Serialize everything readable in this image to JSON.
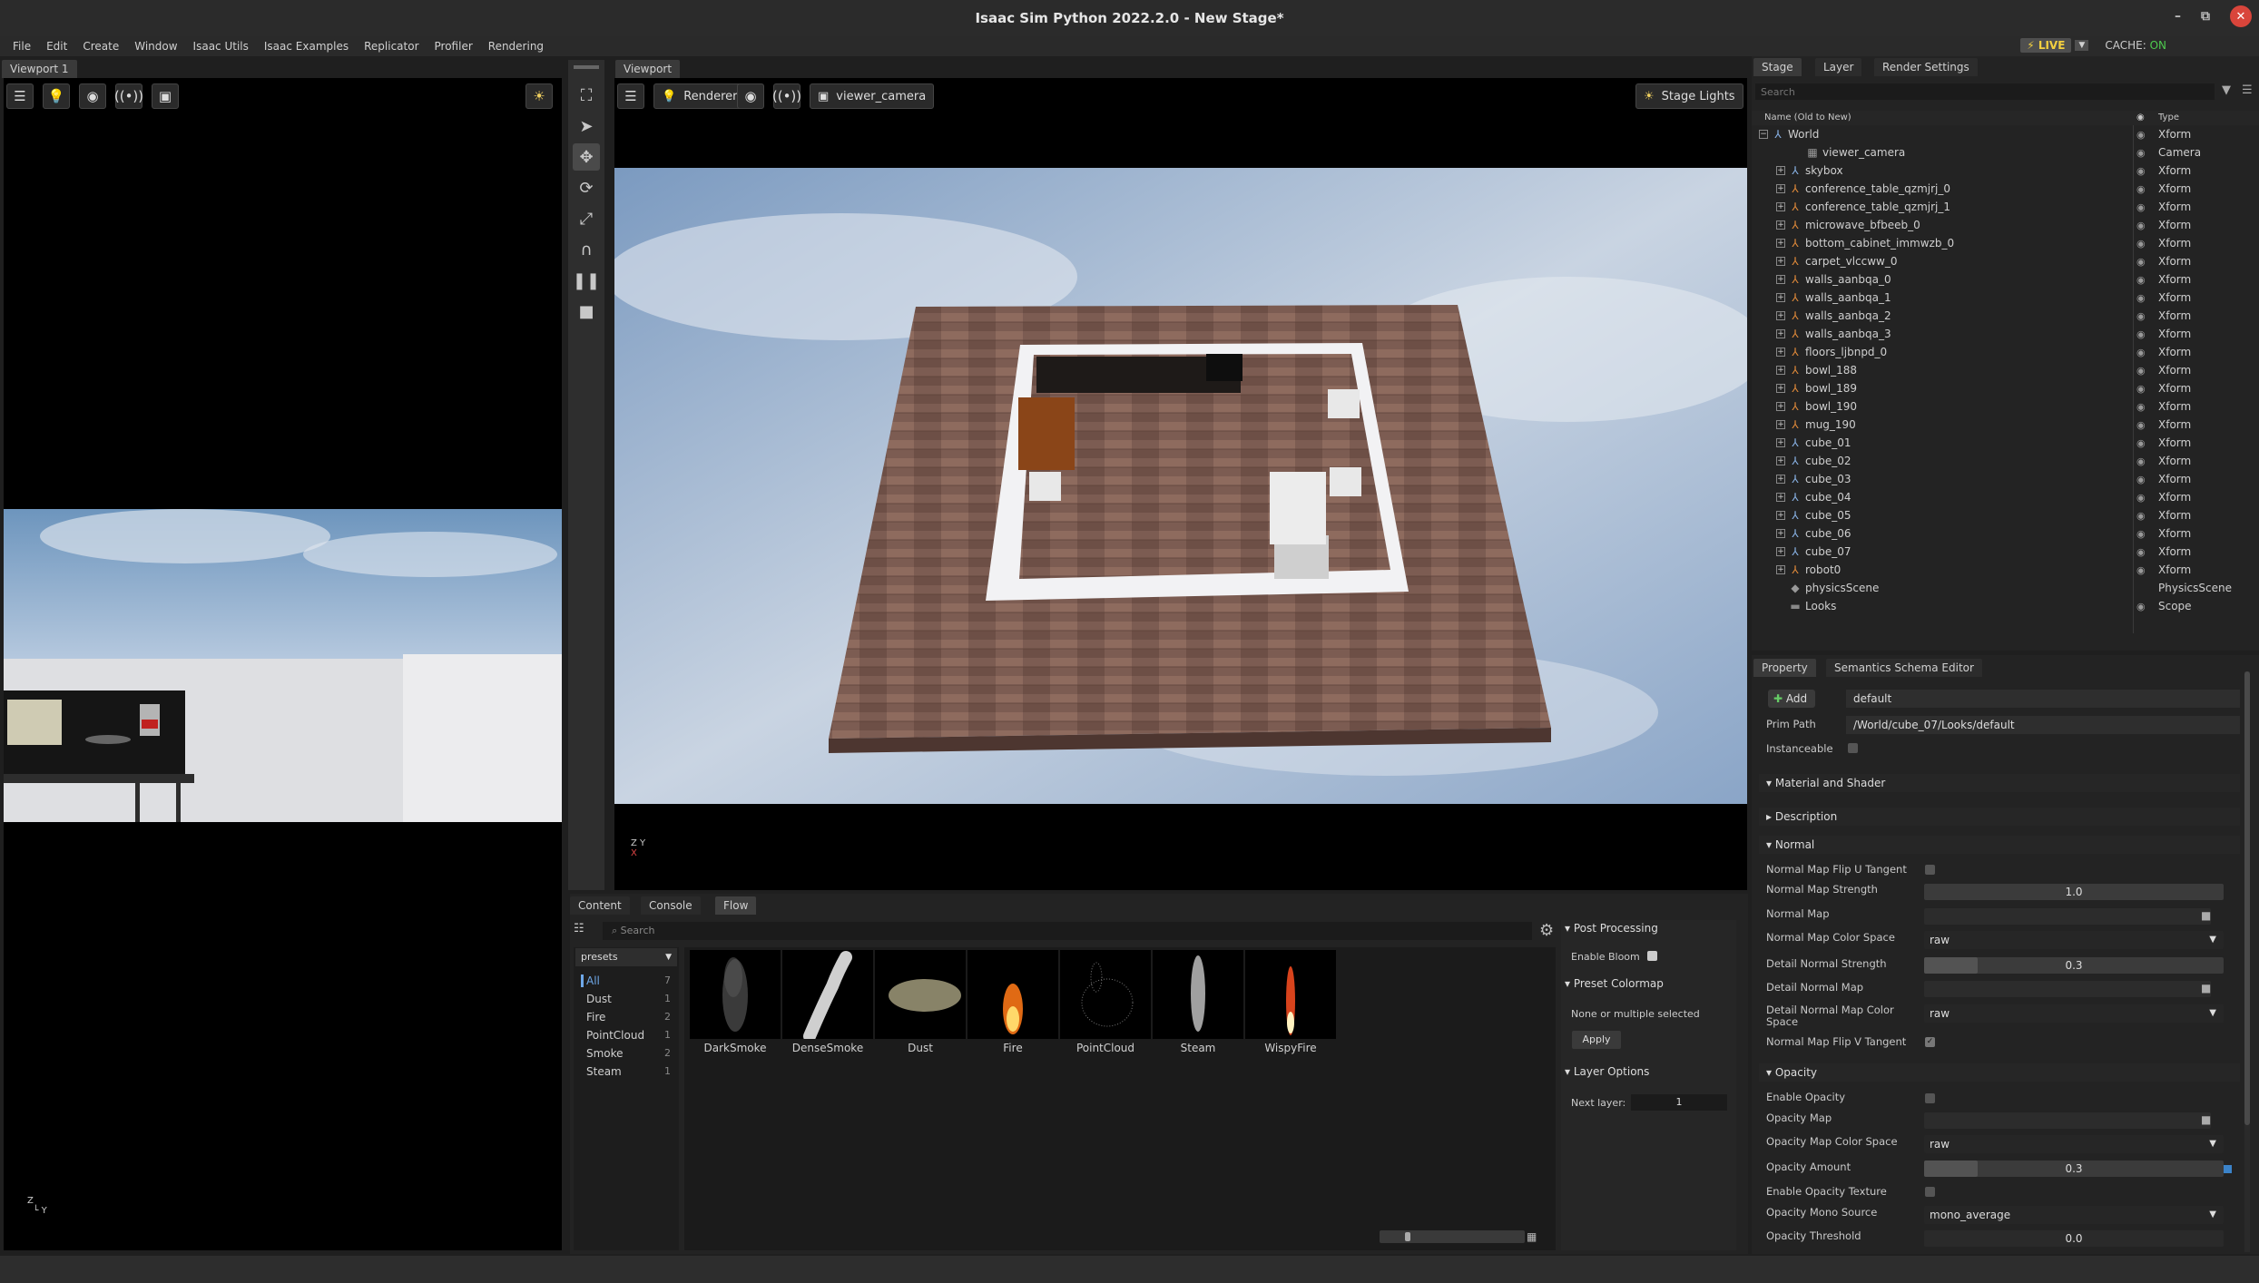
{
  "window": {
    "title": "Isaac Sim Python 2022.2.0 - New Stage*",
    "min": "–",
    "max": "⧉",
    "close": "✕"
  },
  "menu": [
    "File",
    "Edit",
    "Create",
    "Window",
    "Isaac Utils",
    "Isaac Examples",
    "Replicator",
    "Profiler",
    "Rendering"
  ],
  "status": {
    "live": "LIVE",
    "live_icon": "⚡",
    "cache_label": "CACHE:",
    "cache_value": "ON"
  },
  "viewport1": {
    "tab": "Viewport 1",
    "axis_z": "Z",
    "axis_y": "Y"
  },
  "viewport": {
    "tab": "Viewport",
    "renderer": "Renderer",
    "camera": "viewer_camera",
    "stage_lights": "Stage Lights",
    "axis_z": "Z",
    "axis_y": "Y",
    "axis_x": "X"
  },
  "stage": {
    "tabs": [
      "Stage",
      "Layer",
      "Render Settings"
    ],
    "search_placeholder": "Search",
    "col_name": "Name (Old to New)",
    "col_type": "Type",
    "rows": [
      {
        "name": "World",
        "type": "Xform",
        "depth": 0,
        "exp": "−",
        "icon": "xform"
      },
      {
        "name": "viewer_camera",
        "type": "Camera",
        "depth": 2,
        "exp": "",
        "icon": "camera"
      },
      {
        "name": "skybox",
        "type": "Xform",
        "depth": 1,
        "exp": "+",
        "icon": "xform"
      },
      {
        "name": "conference_table_qzmjrj_0",
        "type": "Xform",
        "depth": 1,
        "exp": "+",
        "icon": "ref"
      },
      {
        "name": "conference_table_qzmjrj_1",
        "type": "Xform",
        "depth": 1,
        "exp": "+",
        "icon": "ref"
      },
      {
        "name": "microwave_bfbeeb_0",
        "type": "Xform",
        "depth": 1,
        "exp": "+",
        "icon": "ref"
      },
      {
        "name": "bottom_cabinet_immwzb_0",
        "type": "Xform",
        "depth": 1,
        "exp": "+",
        "icon": "ref"
      },
      {
        "name": "carpet_vlccww_0",
        "type": "Xform",
        "depth": 1,
        "exp": "+",
        "icon": "ref"
      },
      {
        "name": "walls_aanbqa_0",
        "type": "Xform",
        "depth": 1,
        "exp": "+",
        "icon": "ref"
      },
      {
        "name": "walls_aanbqa_1",
        "type": "Xform",
        "depth": 1,
        "exp": "+",
        "icon": "ref"
      },
      {
        "name": "walls_aanbqa_2",
        "type": "Xform",
        "depth": 1,
        "exp": "+",
        "icon": "ref"
      },
      {
        "name": "walls_aanbqa_3",
        "type": "Xform",
        "depth": 1,
        "exp": "+",
        "icon": "ref"
      },
      {
        "name": "floors_ljbnpd_0",
        "type": "Xform",
        "depth": 1,
        "exp": "+",
        "icon": "ref"
      },
      {
        "name": "bowl_188",
        "type": "Xform",
        "depth": 1,
        "exp": "+",
        "icon": "ref"
      },
      {
        "name": "bowl_189",
        "type": "Xform",
        "depth": 1,
        "exp": "+",
        "icon": "ref"
      },
      {
        "name": "bowl_190",
        "type": "Xform",
        "depth": 1,
        "exp": "+",
        "icon": "ref"
      },
      {
        "name": "mug_190",
        "type": "Xform",
        "depth": 1,
        "exp": "+",
        "icon": "ref"
      },
      {
        "name": "cube_01",
        "type": "Xform",
        "depth": 1,
        "exp": "+",
        "icon": "xform"
      },
      {
        "name": "cube_02",
        "type": "Xform",
        "depth": 1,
        "exp": "+",
        "icon": "xform"
      },
      {
        "name": "cube_03",
        "type": "Xform",
        "depth": 1,
        "exp": "+",
        "icon": "xform"
      },
      {
        "name": "cube_04",
        "type": "Xform",
        "depth": 1,
        "exp": "+",
        "icon": "xform"
      },
      {
        "name": "cube_05",
        "type": "Xform",
        "depth": 1,
        "exp": "+",
        "icon": "xform"
      },
      {
        "name": "cube_06",
        "type": "Xform",
        "depth": 1,
        "exp": "+",
        "icon": "xform"
      },
      {
        "name": "cube_07",
        "type": "Xform",
        "depth": 1,
        "exp": "+",
        "icon": "xform"
      },
      {
        "name": "robot0",
        "type": "Xform",
        "depth": 1,
        "exp": "+",
        "icon": "ref"
      },
      {
        "name": "physicsScene",
        "type": "PhysicsScene",
        "depth": 1,
        "exp": "",
        "icon": "scene"
      },
      {
        "name": "Looks",
        "type": "Scope",
        "depth": 1,
        "exp": "",
        "icon": "folder"
      }
    ]
  },
  "property": {
    "tabs": [
      "Property",
      "Semantics Schema Editor"
    ],
    "add": "Add",
    "name_value": "default",
    "prim_path_label": "Prim Path",
    "prim_path": "/World/cube_07/Looks/default",
    "instanceable": "Instanceable",
    "sec_material": "Material and Shader",
    "sec_description": "Description",
    "sec_normal": "Normal",
    "sec_opacity": "Opacity",
    "normal": {
      "flip_u": "Normal Map Flip U Tangent",
      "strength": "Normal Map Strength",
      "strength_v": "1.0",
      "map": "Normal Map",
      "color_space": "Normal Map Color Space",
      "color_space_v": "raw",
      "detail_strength": "Detail Normal Strength",
      "detail_strength_v": "0.3",
      "detail_map": "Detail Normal Map",
      "detail_cs_1": "Detail Normal Map Color",
      "detail_cs_2": "Space",
      "detail_cs_v": "raw",
      "flip_v": "Normal Map Flip V Tangent"
    },
    "opacity": {
      "enable": "Enable Opacity",
      "map": "Opacity Map",
      "color_space": "Opacity Map Color Space",
      "color_space_v": "raw",
      "amount": "Opacity Amount",
      "amount_v": "0.3",
      "enable_tex": "Enable Opacity Texture",
      "mono": "Opacity Mono Source",
      "mono_v": "mono_average",
      "threshold": "Opacity Threshold",
      "threshold_v": "0.0"
    },
    "levels": {
      "normal_strength": 0.0,
      "detail_strength": 0.18,
      "opacity_amount": 0.18
    }
  },
  "bottom": {
    "tabs": [
      "Content",
      "Console",
      "Flow"
    ],
    "search_placeholder": "Search",
    "presets": "presets",
    "categories": [
      {
        "name": "All",
        "count": "7"
      },
      {
        "name": "Dust",
        "count": "1"
      },
      {
        "name": "Fire",
        "count": "2"
      },
      {
        "name": "PointCloud",
        "count": "1"
      },
      {
        "name": "Smoke",
        "count": "2"
      },
      {
        "name": "Steam",
        "count": "1"
      }
    ],
    "thumbs": [
      "DarkSmoke",
      "DenseSmoke",
      "Dust",
      "Fire",
      "PointCloud",
      "Steam",
      "WispyFire"
    ]
  },
  "flowside": {
    "post": "Post Processing",
    "bloom": "Enable Bloom",
    "colormap": "Preset Colormap",
    "none_sel": "None or multiple selected",
    "apply": "Apply",
    "layer_opts": "Layer Options",
    "next_layer": "Next layer:",
    "next_layer_v": "1"
  }
}
